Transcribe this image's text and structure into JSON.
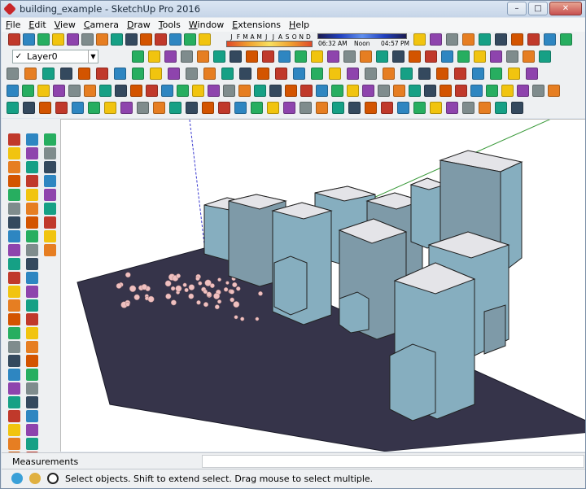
{
  "window": {
    "title": "building_example - SketchUp Pro 2016",
    "controls": {
      "minimize": "–",
      "maximize": "□",
      "close": "✕"
    }
  },
  "menu": [
    "File",
    "Edit",
    "View",
    "Camera",
    "Draw",
    "Tools",
    "Window",
    "Extensions",
    "Help"
  ],
  "layer": {
    "current": "Layer0",
    "check": "✓",
    "dropdown": "▼"
  },
  "shadows": {
    "months": [
      "J",
      "F",
      "M",
      "A",
      "M",
      "J",
      "J",
      "A",
      "S",
      "O",
      "N",
      "D"
    ],
    "time_start": "06:32 AM",
    "time_noon": "Noon",
    "time_end": "04:57 PM"
  },
  "measurements": {
    "label": "Measurements",
    "value": ""
  },
  "status": {
    "text": "Select objects. Shift to extend select. Drag mouse to select multiple."
  },
  "colors": {
    "ground": "#36344a",
    "building_side": "#7e9aa8",
    "building_side_light": "#86aebf",
    "roof": "#e4e4e8",
    "axis_red": "#d04040",
    "axis_green": "#3a9a3a",
    "axis_blue": "#3a3ad0",
    "trees": "#f0c0c0"
  }
}
